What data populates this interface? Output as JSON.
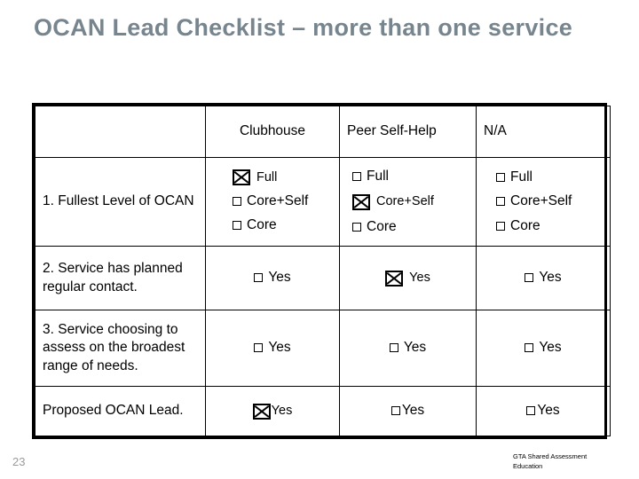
{
  "slide": {
    "title": "OCAN Lead Checklist – more than one service",
    "page_number": "23",
    "footer_line1": "GTA Shared Assessment",
    "footer_line2": "Education",
    "title_color": "#77858f",
    "page_number_color": "#9a9a9a"
  },
  "table": {
    "columns": [
      {
        "key": "label",
        "header": ""
      },
      {
        "key": "clubhouse",
        "header": "Clubhouse"
      },
      {
        "key": "peer",
        "header": "Peer Self-Help"
      },
      {
        "key": "na",
        "header": "N/A"
      }
    ],
    "rows": [
      {
        "label": "1. Fullest Level of OCAN",
        "clubhouse": {
          "options": [
            {
              "label": "Full",
              "checked": true
            },
            {
              "label": "Core+Self",
              "checked": false
            },
            {
              "label": "Core",
              "checked": false
            }
          ]
        },
        "peer": {
          "options": [
            {
              "label": "Full",
              "checked": false
            },
            {
              "label": "Core+Self",
              "checked": true
            },
            {
              "label": "Core",
              "checked": false
            }
          ]
        },
        "na": {
          "options": [
            {
              "label": "Full",
              "checked": false
            },
            {
              "label": "Core+Self",
              "checked": false
            },
            {
              "label": "Core",
              "checked": false
            }
          ]
        }
      },
      {
        "label": "2. Service has planned regular contact.",
        "clubhouse": {
          "options": [
            {
              "label": "Yes",
              "checked": false
            }
          ]
        },
        "peer": {
          "options": [
            {
              "label": "Yes",
              "checked": true
            }
          ]
        },
        "na": {
          "options": [
            {
              "label": "Yes",
              "checked": false
            }
          ]
        }
      },
      {
        "label": "3. Service choosing to assess on the broadest range of needs.",
        "clubhouse": {
          "options": [
            {
              "label": "Yes",
              "checked": false
            }
          ]
        },
        "peer": {
          "options": [
            {
              "label": "Yes",
              "checked": false
            }
          ]
        },
        "na": {
          "options": [
            {
              "label": "Yes",
              "checked": false
            }
          ]
        }
      },
      {
        "label": "Proposed OCAN Lead.",
        "clubhouse": {
          "options": [
            {
              "label": "Yes",
              "checked": true
            }
          ]
        },
        "peer": {
          "options": [
            {
              "label": "Yes",
              "checked": false
            }
          ]
        },
        "na": {
          "options": [
            {
              "label": "Yes",
              "checked": false
            }
          ]
        }
      }
    ]
  }
}
